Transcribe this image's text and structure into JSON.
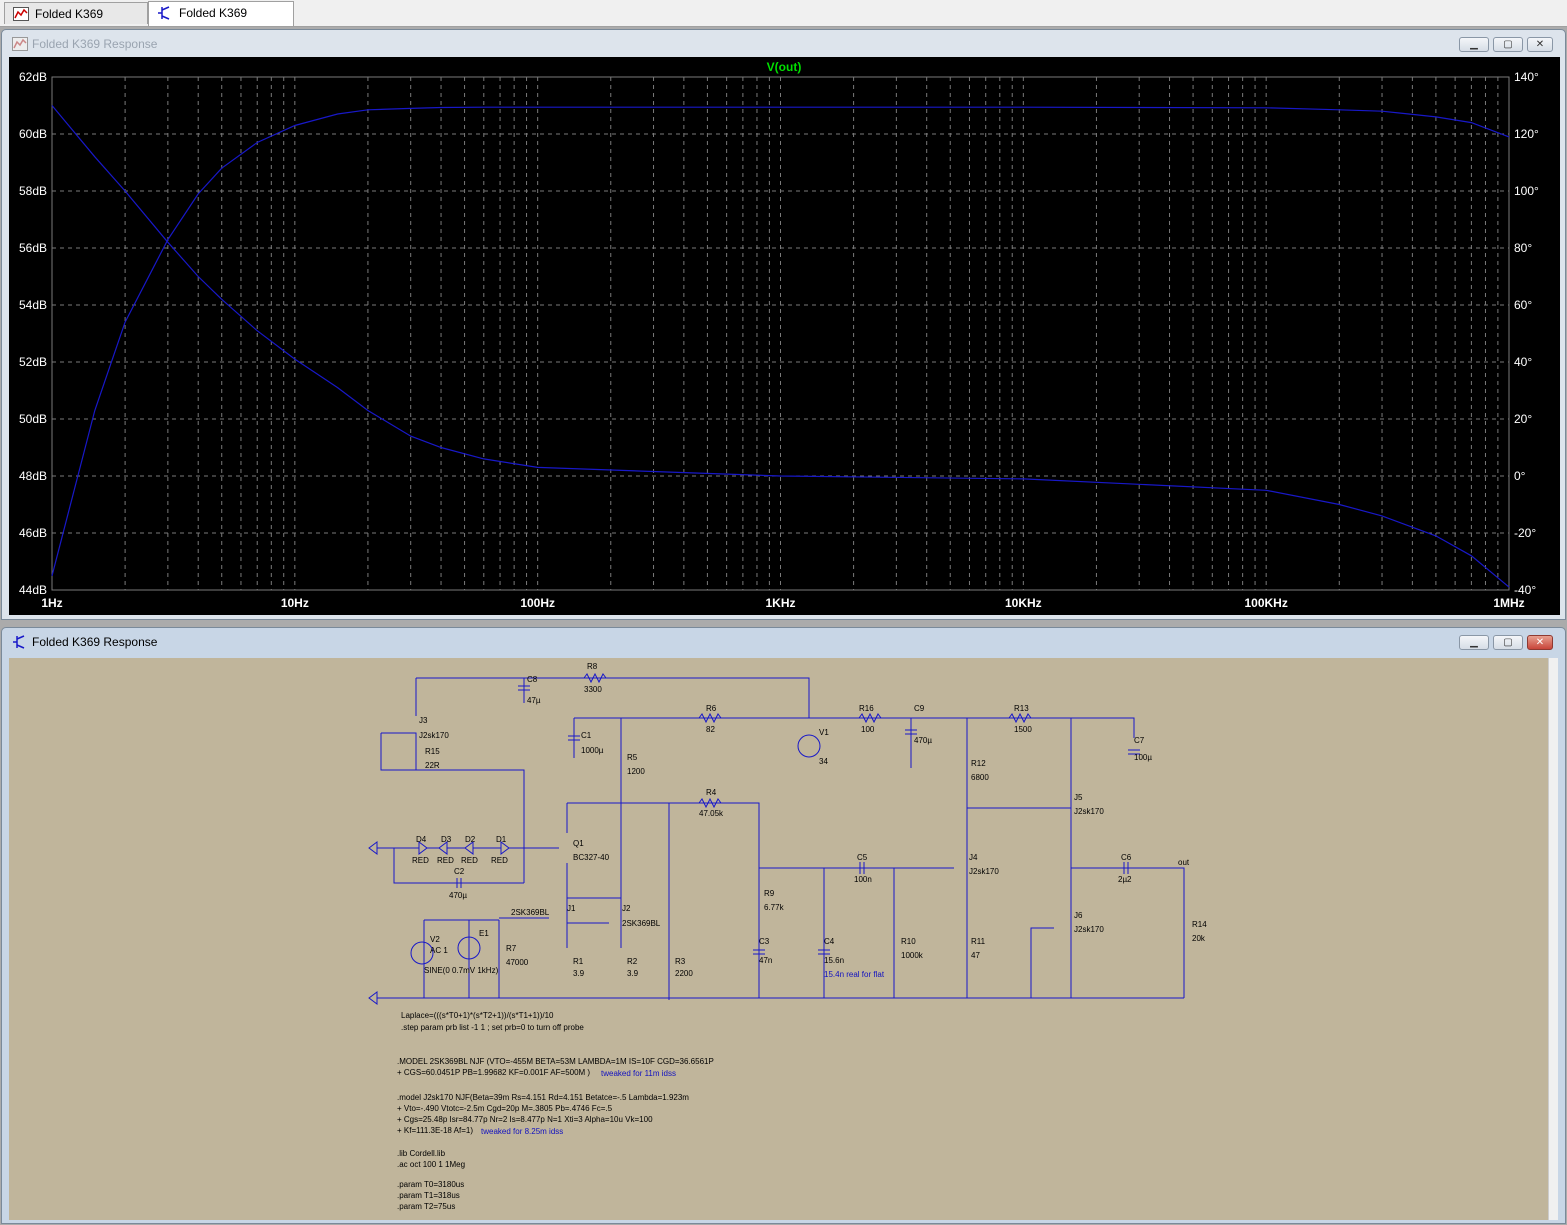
{
  "tabs": [
    {
      "label": "Folded K369 Response",
      "icon": "waveform-icon",
      "active": false
    },
    {
      "label": "Folded K369 Response",
      "icon": "schematic-icon",
      "active": true
    }
  ],
  "plot_window": {
    "title": "Folded K369 Response",
    "trace_label": "V(out)",
    "trace_label_color": "#00e000",
    "trace_color": "#1818c8",
    "grid_color": "#7a7a7a",
    "controls": {
      "minimize": "▁",
      "maximize": "▢",
      "close": "✕"
    }
  },
  "chart_data": {
    "type": "line",
    "title": "V(out)",
    "x_scale": "log",
    "xlim": [
      1,
      1000000
    ],
    "x_ticks": [
      "1Hz",
      "10Hz",
      "100Hz",
      "1KHz",
      "10KHz",
      "100KHz",
      "1MHz"
    ],
    "y_left_ticks": [
      "62dB",
      "60dB",
      "58dB",
      "56dB",
      "54dB",
      "52dB",
      "50dB",
      "48dB",
      "46dB",
      "44dB"
    ],
    "y_left_range": [
      44,
      62
    ],
    "y_right_ticks": [
      "140°",
      "120°",
      "100°",
      "80°",
      "60°",
      "40°",
      "20°",
      "0°",
      "-20°",
      "-40°"
    ],
    "y_right_range": [
      -40,
      140
    ],
    "grid": true,
    "series": [
      {
        "axis": "left",
        "x": [
          1,
          1.5,
          2,
          3,
          4,
          5,
          7,
          10,
          15,
          20,
          30,
          40,
          60,
          100,
          1000,
          10000,
          100000,
          200000,
          300000,
          500000,
          700000,
          1000000
        ],
        "y": [
          44.5,
          50.3,
          53.4,
          56.3,
          57.9,
          58.8,
          59.7,
          60.3,
          60.7,
          60.85,
          60.9,
          60.93,
          60.94,
          60.94,
          60.94,
          60.94,
          60.92,
          60.85,
          60.8,
          60.6,
          60.4,
          59.9
        ]
      },
      {
        "axis": "right",
        "x": [
          1,
          1.5,
          2,
          3,
          4,
          5,
          7,
          10,
          15,
          20,
          30,
          40,
          60,
          100,
          1000,
          10000,
          100000,
          200000,
          300000,
          500000,
          700000,
          1000000
        ],
        "y": [
          130,
          112,
          100,
          82,
          70,
          62,
          51,
          41,
          31,
          23,
          14,
          10,
          6,
          3,
          0,
          -1,
          -5,
          -10,
          -14,
          -21,
          -28,
          -39
        ]
      }
    ]
  },
  "schematic_window": {
    "title": "Folded K369 Response",
    "controls": {
      "minimize": "▁",
      "maximize": "▢",
      "close": "✕"
    },
    "wire_color": "#1818c8",
    "components": {
      "c8": "C8",
      "c8v": "47µ",
      "r8": "R8",
      "r8v": "3300",
      "j3": "J3",
      "j3v": "J2sk170",
      "r15": "R15",
      "r15v": "22R",
      "c1": "C1",
      "c1v": "1000µ",
      "r6": "R6",
      "r6v": "82",
      "r5": "R5",
      "r5v": "1200",
      "v1": "V1",
      "v1v": "34",
      "r16": "R16",
      "r16v": "100",
      "c9": "C9",
      "c9v": "470µ",
      "r13": "R13",
      "r13v": "1500",
      "c7": "C7",
      "c7v": "100µ",
      "r12": "R12",
      "r12v": "6800",
      "r4": "R4",
      "r4v": "47.05k",
      "j5": "J5",
      "j5v": "J2sk170",
      "d4": "D4",
      "d3": "D3",
      "d2": "D2",
      "d1": "D1",
      "dv": "RED",
      "q1": "Q1",
      "q1v": "BC327-40",
      "c2": "C2",
      "c2v": "470µ",
      "c5": "C5",
      "c5v": "100n",
      "j4": "J4",
      "j4v": "J2sk170",
      "c6": "C6",
      "c6v": "2µ2",
      "out": "out",
      "r9": "R9",
      "r9v": "6.77k",
      "j1": "J1",
      "j1v": "2SK369BL",
      "j2": "J2",
      "j2v": "2SK369BL",
      "j6": "J6",
      "j6v": "J2sk170",
      "r14": "R14",
      "r14v": "20k",
      "v2": "V2",
      "v2v": "AC 1",
      "v2s": "SINE(0 0.7mV 1kHz)",
      "e1": "E1",
      "r7": "R7",
      "r7v": "47000",
      "c3": "C3",
      "c3v": "47n",
      "c4": "C4",
      "c4v": "15.6n",
      "c4n": "15.4n real for flat",
      "r10": "R10",
      "r10v": "1000k",
      "r11": "R11",
      "r11v": "47",
      "r1": "R1",
      "r1v": "3.9",
      "r2": "R2",
      "r2v": "3.9",
      "r3": "R3",
      "r3v": "2200"
    },
    "directives": [
      {
        "text": "Laplace=(((s*T0+1)*(s*T2+1))/(s*T1+1))/10",
        "color": "black"
      },
      {
        "text": ".step param prb list -1 1 ; set prb=0 to turn off probe",
        "color": "black"
      },
      {
        "text": ".MODEL 2SK369BL NJF (VTO=-455M BETA=53M LAMBDA=1M IS=10F CGD=36.6561P",
        "color": "black"
      },
      {
        "text": "+ CGS=60.0451P PB=1.99682 KF=0.001F AF=500M )",
        "color": "black"
      },
      {
        "text": "tweaked for 11m idss",
        "color": "blue"
      },
      {
        "text": ".model J2sk170 NJF(Beta=39m Rs=4.151 Rd=4.151 Betatce=-.5 Lambda=1.923m",
        "color": "black"
      },
      {
        "text": "+ Vto=-.490 Vtotc=-2.5m Cgd=20p M=.3805 Pb=.4746 Fc=.5",
        "color": "black"
      },
      {
        "text": "+ Cgs=25.48p Isr=84.77p Nr=2 Is=8.477p N=1 Xti=3 Alpha=10u Vk=100",
        "color": "black"
      },
      {
        "text": "+ Kf=111.3E-18 Af=1)",
        "color": "black"
      },
      {
        "text": "tweaked for 8.25m idss",
        "color": "blue"
      },
      {
        "text": ".lib Cordell.lib",
        "color": "black"
      },
      {
        "text": ".ac oct 100 1 1Meg",
        "color": "black"
      },
      {
        "text": ".param T0=3180us",
        "color": "black"
      },
      {
        "text": ".param T1=318us",
        "color": "black"
      },
      {
        "text": ".param T2=75us",
        "color": "black"
      }
    ]
  }
}
